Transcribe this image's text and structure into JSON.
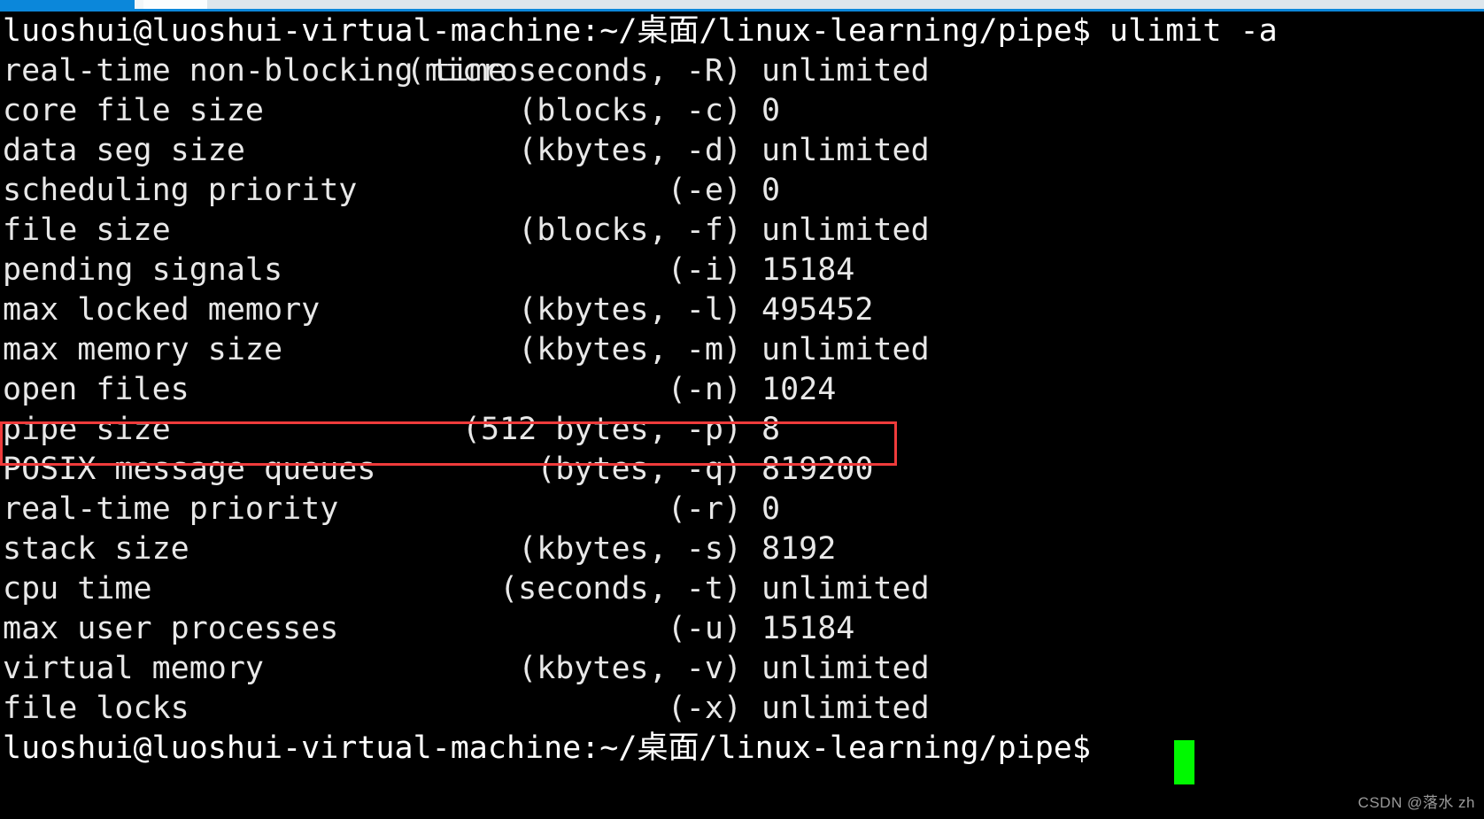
{
  "window": {
    "titlebar_active_color": "#0b87da",
    "titlebar_bg_color": "#d3dde4"
  },
  "terminal": {
    "background_color": "#000000",
    "foreground_color": "#e8e8e8",
    "cursor_color": "#00f900",
    "highlight_color": "#ef3b3b",
    "prompt_top": "luoshui@luoshui-virtual-machine:~/桌面/linux-learning/pipe$ ulimit -a",
    "prompt_bottom": "luoshui@luoshui-virtual-machine:~/桌面/linux-learning/pipe$ ",
    "command": "ulimit -a",
    "user_host": "luoshui@luoshui-virtual-machine",
    "cwd": "~/桌面/linux-learning/pipe",
    "lines": [
      {
        "desc": "real-time non-blocking time",
        "unitflag": "(microseconds, -R)",
        "value": "unlimited"
      },
      {
        "desc": "core file size",
        "unitflag": "(blocks, -c)",
        "value": "0"
      },
      {
        "desc": "data seg size",
        "unitflag": "(kbytes, -d)",
        "value": "unlimited"
      },
      {
        "desc": "scheduling priority",
        "unitflag": "(-e)",
        "value": "0"
      },
      {
        "desc": "file size",
        "unitflag": "(blocks, -f)",
        "value": "unlimited"
      },
      {
        "desc": "pending signals",
        "unitflag": "(-i)",
        "value": "15184"
      },
      {
        "desc": "max locked memory",
        "unitflag": "(kbytes, -l)",
        "value": "495452"
      },
      {
        "desc": "max memory size",
        "unitflag": "(kbytes, -m)",
        "value": "unlimited"
      },
      {
        "desc": "open files",
        "unitflag": "(-n)",
        "value": "1024"
      },
      {
        "desc": "pipe size",
        "unitflag": "(512 bytes, -p)",
        "value": "8"
      },
      {
        "desc": "POSIX message queues",
        "unitflag": "(bytes, -q)",
        "value": "819200"
      },
      {
        "desc": "real-time priority",
        "unitflag": "(-r)",
        "value": "0"
      },
      {
        "desc": "stack size",
        "unitflag": "(kbytes, -s)",
        "value": "8192"
      },
      {
        "desc": "cpu time",
        "unitflag": "(seconds, -t)",
        "value": "unlimited"
      },
      {
        "desc": "max user processes",
        "unitflag": "(-u)",
        "value": "15184"
      },
      {
        "desc": "virtual memory",
        "unitflag": "(kbytes, -v)",
        "value": "unlimited"
      },
      {
        "desc": "file locks",
        "unitflag": "(-x)",
        "value": "unlimited"
      }
    ],
    "highlighted_line_index": 9
  },
  "watermark": {
    "text": "CSDN @落水 zh"
  }
}
